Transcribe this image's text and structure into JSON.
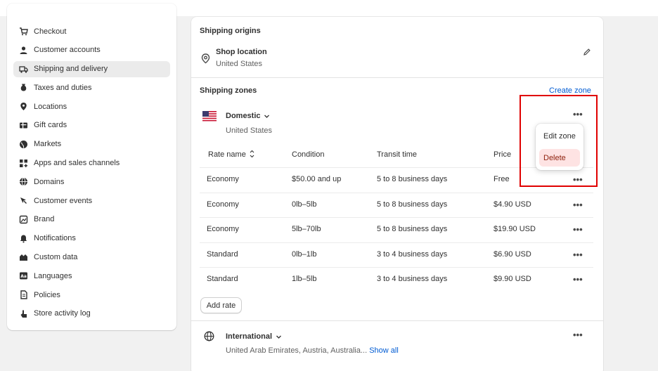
{
  "sidebar": {
    "items": [
      {
        "label": "Checkout",
        "icon": "cart-icon"
      },
      {
        "label": "Customer accounts",
        "icon": "person-icon"
      },
      {
        "label": "Shipping and delivery",
        "icon": "truck-icon",
        "active": true
      },
      {
        "label": "Taxes and duties",
        "icon": "tax-icon"
      },
      {
        "label": "Locations",
        "icon": "location-icon"
      },
      {
        "label": "Gift cards",
        "icon": "gift-card-icon"
      },
      {
        "label": "Markets",
        "icon": "globe-icon"
      },
      {
        "label": "Apps and sales channels",
        "icon": "apps-icon"
      },
      {
        "label": "Domains",
        "icon": "domain-globe-icon"
      },
      {
        "label": "Customer events",
        "icon": "cursor-icon"
      },
      {
        "label": "Brand",
        "icon": "brand-icon"
      },
      {
        "label": "Notifications",
        "icon": "bell-icon"
      },
      {
        "label": "Custom data",
        "icon": "custom-data-icon"
      },
      {
        "label": "Languages",
        "icon": "language-icon"
      },
      {
        "label": "Policies",
        "icon": "policy-icon"
      },
      {
        "label": "Store activity log",
        "icon": "activity-log-icon"
      }
    ]
  },
  "origins": {
    "title": "Shipping origins",
    "location_name": "Shop location",
    "location_country": "United States"
  },
  "zones": {
    "title": "Shipping zones",
    "create_label": "Create zone",
    "domestic": {
      "name": "Domestic",
      "country": "United States",
      "columns": [
        "Rate name",
        "Condition",
        "Transit time",
        "Price"
      ],
      "rows": [
        {
          "name": "Economy",
          "condition": "$50.00 and up",
          "transit": "5 to 8 business days",
          "price": "Free"
        },
        {
          "name": "Economy",
          "condition": "0lb–5lb",
          "transit": "5 to 8 business days",
          "price": "$4.90 USD"
        },
        {
          "name": "Economy",
          "condition": "5lb–70lb",
          "transit": "5 to 8 business days",
          "price": "$19.90 USD"
        },
        {
          "name": "Standard",
          "condition": "0lb–1lb",
          "transit": "3 to 4 business days",
          "price": "$6.90 USD"
        },
        {
          "name": "Standard",
          "condition": "1lb–5lb",
          "transit": "3 to 4 business days",
          "price": "$9.90 USD"
        }
      ],
      "add_rate_label": "Add rate"
    },
    "international": {
      "name": "International",
      "countries": "United Arab Emirates, Austria, Australia...",
      "show_all_label": "Show all"
    }
  },
  "popover": {
    "edit_label": "Edit zone",
    "delete_label": "Delete"
  },
  "colors": {
    "link": "#005bd3",
    "highlight": "#e00000",
    "danger_bg": "#fee3e3"
  }
}
